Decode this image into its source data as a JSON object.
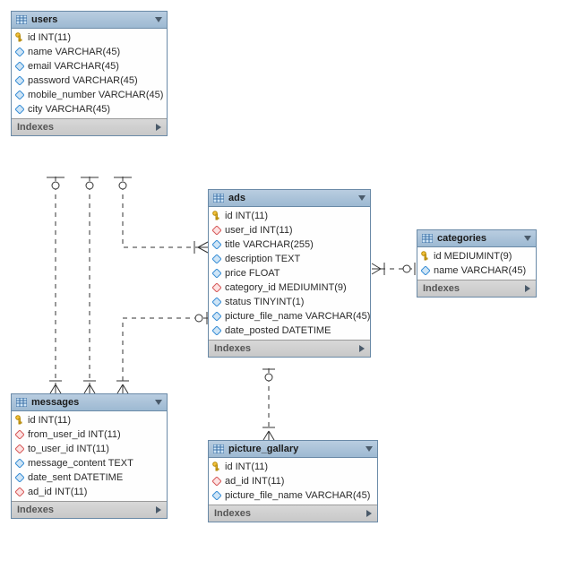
{
  "footer_label": "Indexes",
  "colors": {
    "header_top": "#b9cde0",
    "header_bottom": "#9db9d2",
    "border": "#6a8aa7",
    "footer": "#c8c8c8",
    "key": "#f6c33c",
    "attr": "#3a8fd6",
    "fk": "#d65a5a"
  },
  "entities": [
    {
      "name": "users",
      "columns": [
        "id INT(11)",
        "name VARCHAR(45)",
        "email VARCHAR(45)",
        "password VARCHAR(45)",
        "mobile_number VARCHAR(45)",
        "city VARCHAR(45)"
      ]
    },
    {
      "name": "ads",
      "columns": [
        "id INT(11)",
        "user_id INT(11)",
        "title VARCHAR(255)",
        "description TEXT",
        "price FLOAT",
        "category_id MEDIUMINT(9)",
        "status TINYINT(1)",
        "picture_file_name VARCHAR(45)",
        "date_posted DATETIME"
      ]
    },
    {
      "name": "categories",
      "columns": [
        "id MEDIUMINT(9)",
        "name VARCHAR(45)"
      ]
    },
    {
      "name": "messages",
      "columns": [
        "id INT(11)",
        "from_user_id INT(11)",
        "to_user_id INT(11)",
        "message_content TEXT",
        "date_sent DATETIME",
        "ad_id INT(11)"
      ]
    },
    {
      "name": "picture_gallary",
      "columns": [
        "id INT(11)",
        "ad_id INT(11)",
        "picture_file_name VARCHAR(45)"
      ]
    }
  ],
  "relationships": [
    {
      "from": "users.id",
      "to": "ads.user_id",
      "type": "one-optional-to-many"
    },
    {
      "from": "users.id",
      "to": "messages.from_user_id",
      "type": "one-optional-to-many"
    },
    {
      "from": "users.id",
      "to": "messages.to_user_id",
      "type": "one-optional-to-many"
    },
    {
      "from": "ads.id",
      "to": "messages.ad_id",
      "type": "one-optional-to-many"
    },
    {
      "from": "categories.id",
      "to": "ads.category_id",
      "type": "one-optional-to-many"
    },
    {
      "from": "ads.id",
      "to": "picture_gallary.ad_id",
      "type": "one-optional-to-many"
    }
  ]
}
